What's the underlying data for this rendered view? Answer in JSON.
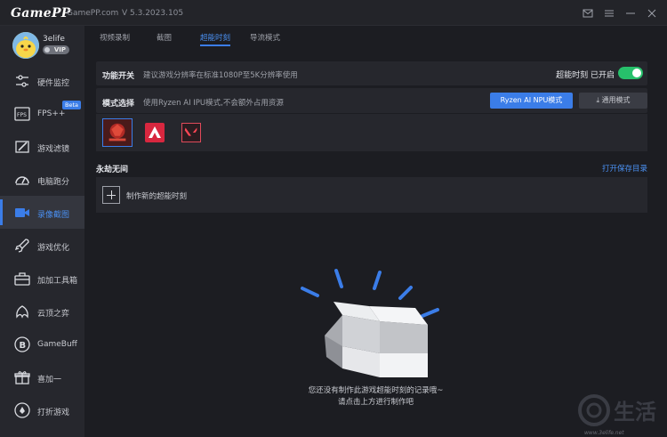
{
  "app": {
    "logo": "GamePP",
    "site": "GamePP.com",
    "version": "V 5.3.2023.105"
  },
  "window_controls": [
    "mail-icon",
    "menu-icon",
    "minimize-icon",
    "close-icon"
  ],
  "user": {
    "name": "3elife",
    "badge": "VIP"
  },
  "sidebar": {
    "items": [
      {
        "label": "硬件监控",
        "icon": "hardware-monitor-icon"
      },
      {
        "label": "FPS++",
        "icon": "fps-icon",
        "badge": "Beta"
      },
      {
        "label": "游戏滤镜",
        "icon": "filter-icon"
      },
      {
        "label": "电脑跑分",
        "icon": "benchmark-icon"
      },
      {
        "label": "录像截图",
        "icon": "camera-icon",
        "active": true
      },
      {
        "label": "游戏优化",
        "icon": "rocket-icon"
      },
      {
        "label": "加加工具箱",
        "icon": "toolbox-icon"
      },
      {
        "label": "云顶之弈",
        "icon": "tft-icon"
      },
      {
        "label": "GameBuff",
        "icon": "gamebuff-icon"
      },
      {
        "label": "喜加一",
        "icon": "gift-icon"
      },
      {
        "label": "打折游戏",
        "icon": "discount-icon"
      }
    ]
  },
  "tabs": [
    {
      "label": "视频录制"
    },
    {
      "label": "截图"
    },
    {
      "label": "超能时刻",
      "active": true
    },
    {
      "label": "导流模式"
    }
  ],
  "feature_switch": {
    "label": "功能开关",
    "desc": "建议游戏分辨率在标准1080P至5K分辨率使用",
    "toggle_text": "超能时刻 已开启",
    "enabled": true
  },
  "mode_select": {
    "label": "模式选择",
    "desc": "使用Ryzen AI IPU模式,不会额外占用资源",
    "primary_button": "Ryzen AI NPU模式",
    "secondary_button": "通用模式"
  },
  "games": [
    "naraka-game-icon",
    "apex-game-icon",
    "valorant-game-icon"
  ],
  "section": {
    "title": "永劫无间",
    "open_dir": "打开保存目录"
  },
  "create": {
    "label": "制作新的超能时刻"
  },
  "empty": {
    "line1": "您还没有制作此游戏超能时刻的记录哦~",
    "line2": "请点击上方进行制作吧"
  },
  "watermark": {
    "text": "生活",
    "url": "www.3elife.net"
  },
  "colors": {
    "accent": "#3b7de8",
    "toggle_on": "#27c06b",
    "background": "#1c1d22",
    "sidebar": "#26272d"
  }
}
